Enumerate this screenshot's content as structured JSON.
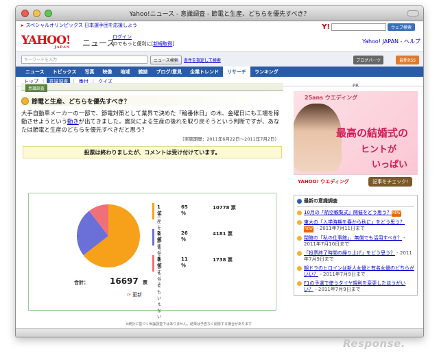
{
  "window": {
    "title": "Yahoo!ニュース - 意識調査 - 節電と生産、どちらを優先すべき？"
  },
  "topbar": {
    "promo_link": "スペシャルオリンピックス 日本選手団を応援しよう",
    "search_button": "ウェブ検索"
  },
  "header": {
    "logo_text": "YAHOO!",
    "logo_sub": "JAPAN",
    "section_name": "ニュース",
    "login_label": "ログイン",
    "login_note": "IDでもっと便利に[",
    "register_link": "新規取得",
    "register_close": "]",
    "right_links": "Yahoo! JAPAN - ヘルプ"
  },
  "search": {
    "placeholder": "キーワードを入力",
    "news_search_button": "ニュース検索",
    "advanced_link": "条件を指定して検索",
    "blog_parts_button": "ブログパーツ",
    "rss_button": "最新RSS"
  },
  "nav": {
    "tabs": [
      "ニュース",
      "トピックス",
      "写真",
      "映像",
      "地域",
      "雑誌",
      "ブログ/意見",
      "企業トレンド",
      "リサーチ",
      "ランキング"
    ],
    "active_index": 8
  },
  "subnav": {
    "items": [
      "トップ",
      "意識調査",
      "番付",
      "クイズ"
    ],
    "active_index": 1
  },
  "survey": {
    "section_tab": "意識調査",
    "question": "節電と生産、どちらを優先すべき？",
    "description_1": "大手自動車メーカーの一部で、節電対策として業界で決めた「輪番休日」の木、金曜日にも工場を稼動させようという",
    "description_link": "動き",
    "description_2": "が出てきました。震災による生産の後れを取り戻そうという判断ですが、あなたは節電と生産のどちらを優先すべきだと思う？",
    "period": "（実施期間：2011年6月22日〜2011年7月2日）",
    "closed_notice": "投票は終わりましたが、コメントは受け付けています。",
    "total_label": "合計：",
    "total_votes": "16697",
    "votes_unit": "票",
    "refresh_label": "更新",
    "footnote": "※統計に基づく世論調査ではありません。結果は予告なく削除する場合があります"
  },
  "chart_data": {
    "type": "pie",
    "categories": [
      "生産を優先すべき",
      "節電を優先すべき",
      "どちらともいえない"
    ],
    "ranks": [
      "1 位",
      "2 位",
      "3 位"
    ],
    "percents": [
      65,
      26,
      11
    ],
    "percent_unit": "％",
    "values": [
      10778,
      4181,
      1738
    ],
    "colors": [
      "#f7a11a",
      "#6b6fd8",
      "#f0707a"
    ]
  },
  "sidebar": {
    "pr_label": "PR",
    "ad": {
      "brand": "25ans ウエディング",
      "headline_1": "最高の結婚式の",
      "headline_2": "ヒントが",
      "headline_3": "いっぱい",
      "footer_brand": "YAHOO! ウエディング",
      "cta": "記事をチェック!"
    },
    "latest_title": "最新の意識調査",
    "latest": [
      {
        "title": "10月の「航空観覧式」開催をどう思う？",
        "date": ""
      },
      {
        "title": "東大の「入学時期を春から秋に」をどう思う？",
        "date": "2011年7月11日まで"
      },
      {
        "title": "閉館の「私の仕事館」、無償でも活用すべき？",
        "date": "2011年7月10日まで"
      },
      {
        "title": "「投票終了時間の繰り上げ」をどう思う？",
        "date": "2011年7月9日まで"
      },
      {
        "title": "朝ドラのヒロインは新人女優と有名女優のどちらがいい？",
        "date": "2011年7月9日まで"
      },
      {
        "title": "F1の予選で使うタイヤ規則を変更したほうがいい？",
        "date": "2011年7月9日まで"
      }
    ]
  },
  "watermark": "Response."
}
